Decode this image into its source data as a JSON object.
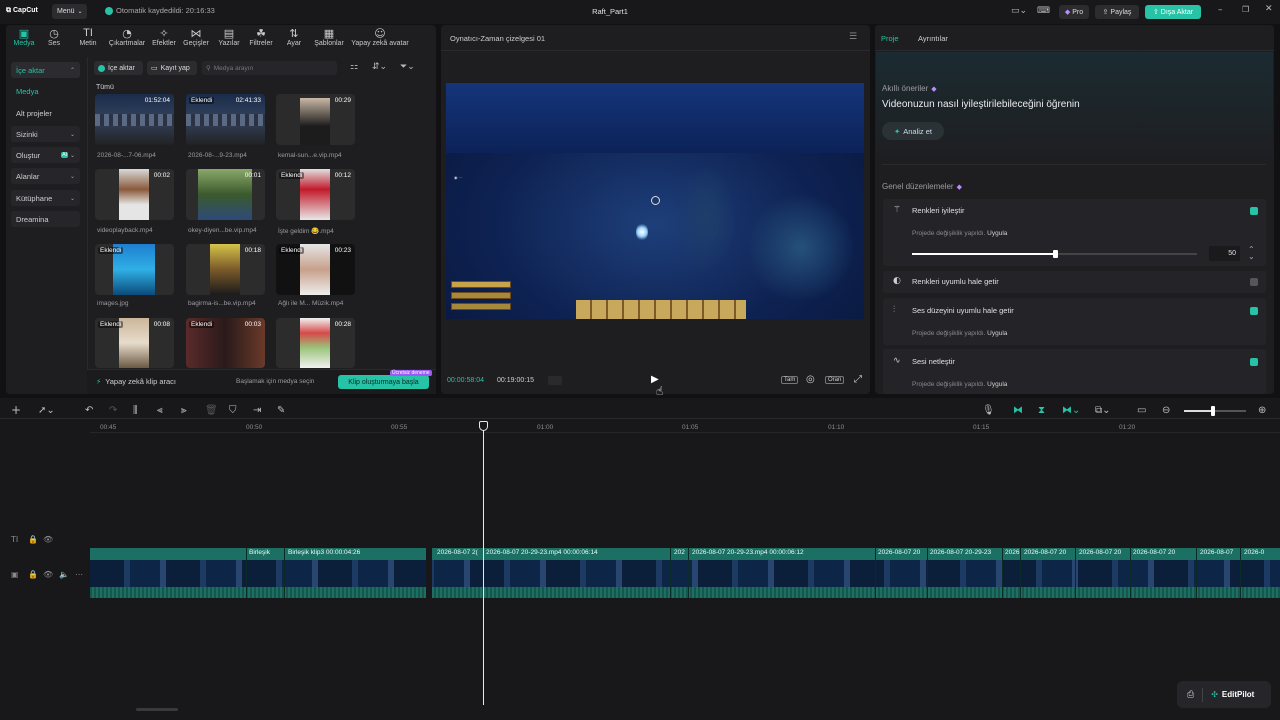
{
  "titlebar": {
    "logo": "CapCut",
    "menu_label": "Menü",
    "autosave": "Otomatik kaydedildi: 20:16:33",
    "project_name": "Raft_Part1",
    "pro_label": "Pro",
    "share_label": "Paylaş",
    "export_label": "Dışa Aktar"
  },
  "topnav": [
    {
      "label": "Medya",
      "icon": "media-icon"
    },
    {
      "label": "Ses",
      "icon": "audio-icon"
    },
    {
      "label": "Metin",
      "icon": "text-icon"
    },
    {
      "label": "Çıkartmalar",
      "icon": "sticker-icon"
    },
    {
      "label": "Efektler",
      "icon": "effects-icon"
    },
    {
      "label": "Geçişler",
      "icon": "transitions-icon"
    },
    {
      "label": "Yazılar",
      "icon": "captions-icon"
    },
    {
      "label": "Filtreler",
      "icon": "filters-icon"
    },
    {
      "label": "Ayar",
      "icon": "adjust-icon"
    },
    {
      "label": "Şablonlar",
      "icon": "templates-icon"
    },
    {
      "label": "Yapay zekâ avatar",
      "icon": "ai-avatar-icon"
    }
  ],
  "sidebar": {
    "items": [
      {
        "label": "İçe aktar"
      },
      {
        "label": "Medya"
      },
      {
        "label": "Alt projeler"
      },
      {
        "label": "Sizinki"
      },
      {
        "label": "Oluştur"
      },
      {
        "label": "Alanlar"
      },
      {
        "label": "Kütüphane"
      },
      {
        "label": "Dreamina"
      }
    ],
    "new_badge": "AI"
  },
  "media": {
    "import_label": "İçe aktar",
    "record_label": "Kayıt yap",
    "search_placeholder": "Medya arayın",
    "all_label": "Tümü",
    "items": [
      {
        "name": "2026-08-...7-06.mp4",
        "duration": "01:52:04",
        "tag": ""
      },
      {
        "name": "2026-08-...9-23.mp4",
        "duration": "02:41:33",
        "tag": "Eklendi"
      },
      {
        "name": "kemal-sun...e.vip.mp4",
        "duration": "00:29",
        "tag": ""
      },
      {
        "name": "videoplayback.mp4",
        "duration": "00:02",
        "tag": ""
      },
      {
        "name": "okey-diyen...be.vip.mp4",
        "duration": "00:01",
        "tag": ""
      },
      {
        "name": "İşte geldim 😂.mp4",
        "duration": "00:12",
        "tag": "Eklendi"
      },
      {
        "name": "images.jpg",
        "duration": "",
        "tag": "Eklendi"
      },
      {
        "name": "bagirma-is...be.vip.mp4",
        "duration": "00:18",
        "tag": ""
      },
      {
        "name": "Ağlı ile M... Müzik.mp4",
        "duration": "00:23",
        "tag": "Eklendi"
      },
      {
        "name": "",
        "duration": "00:08",
        "tag": "Eklendi"
      },
      {
        "name": "",
        "duration": "00:03",
        "tag": "Eklendi"
      },
      {
        "name": "",
        "duration": "00:28",
        "tag": ""
      }
    ],
    "ai_clip_tool": "Yapay zekâ klip aracı",
    "select_hint": "Başlamak için medya seçin",
    "start_clip": "Klip oluşturmaya başla",
    "free_badge": "Ücretsiz deneme"
  },
  "player": {
    "title": "Oynatıcı-Zaman çizelgesi 01",
    "current_time": "00:00:58:04",
    "total_time": "00:19:00:15",
    "full_label": "Tam",
    "ratio_label": "Oran"
  },
  "inspector": {
    "tabs": [
      "Proje",
      "Ayrıntılar"
    ],
    "smart_title": "Akıllı öneriler",
    "smart_heading": "Videonuzun nasıl iyileştirilebileceğini öğrenin",
    "analyze_label": "Analiz et",
    "general_title": "Genel düzenlemeler",
    "rows": [
      {
        "label": "Renkleri iyileştir",
        "enabled": true,
        "note": "Projede değişiklik yapıldı.",
        "apply": "Uygula",
        "slider_value": "50"
      },
      {
        "label": "Renkleri uyumlu hale getir",
        "enabled": false
      },
      {
        "label": "Ses düzeyini uyumlu hale getir",
        "enabled": true,
        "note": "Projede değişiklik yapıldı.",
        "apply": "Uygula"
      },
      {
        "label": "Sesi netleştir",
        "enabled": true,
        "note": "Projede değişiklik yapıldı.",
        "apply": "Uygula"
      }
    ],
    "slider_level": 0.5
  },
  "timeline": {
    "ruler": [
      "00:45",
      "00:50",
      "00:55",
      "01:00",
      "01:05",
      "01:10",
      "01:15",
      "01:20"
    ],
    "clips": [
      {
        "label": "Birleşik"
      },
      {
        "label": "Birleşik klip3  00:00:04:26"
      },
      {
        "label": "2026-08-07 2("
      },
      {
        "label": "2026-08-07 20-29-23.mp4  00:00:06:14"
      },
      {
        "label": "202"
      },
      {
        "label": "2026-08-07 20-29-23.mp4  00:00:06:12"
      },
      {
        "label": "2026-08-07 20"
      },
      {
        "label": "2026-08-07 20-29-23"
      },
      {
        "label": "2026"
      },
      {
        "label": "2026-08-07 20"
      },
      {
        "label": "2026-08-07 20"
      },
      {
        "label": "2026-08-07 20"
      },
      {
        "label": "2026-08-07"
      },
      {
        "label": "2026-0"
      }
    ],
    "editpilot": "EditPilot"
  },
  "colors": {
    "accent": "#26c3a6",
    "panel": "#1e1e21",
    "background": "#111113",
    "clip": "#1c6f63"
  }
}
